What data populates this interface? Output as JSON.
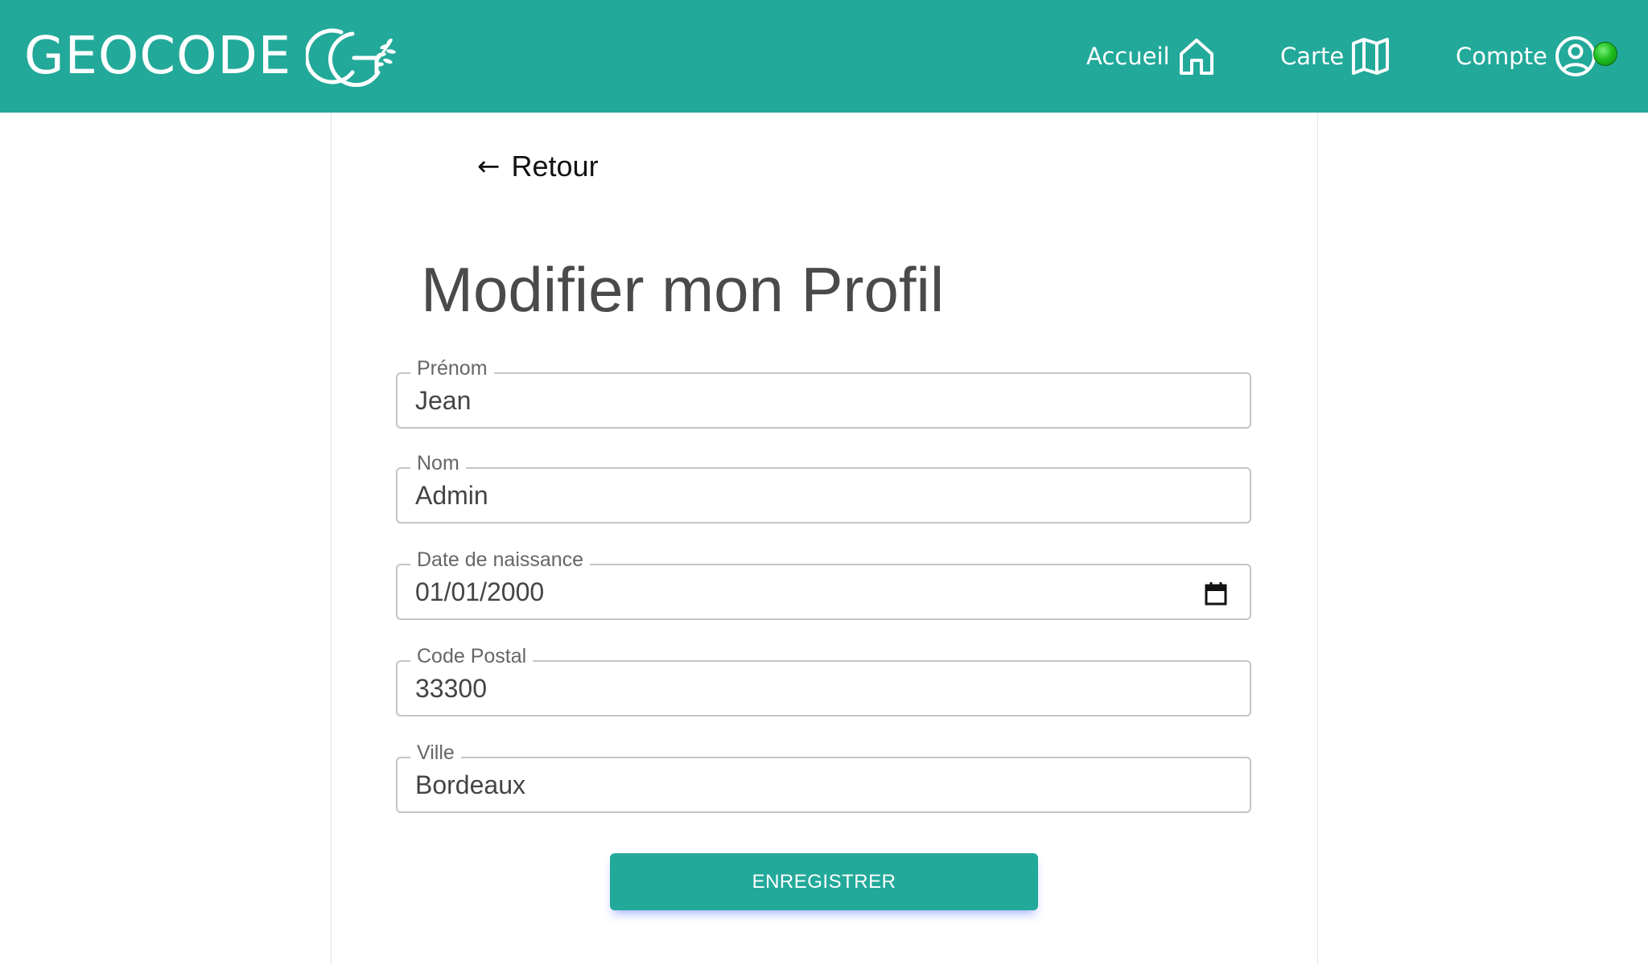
{
  "header": {
    "brand": "GEOCODE",
    "nav": {
      "home": "Accueil",
      "map": "Carte",
      "account": "Compte"
    },
    "status_color": "#22c022"
  },
  "page": {
    "back_label": "Retour",
    "title": "Modifier mon Profil"
  },
  "form": {
    "first_name": {
      "label": "Prénom",
      "value": "Jean"
    },
    "last_name": {
      "label": "Nom",
      "value": "Admin"
    },
    "birth_date": {
      "label": "Date de naissance",
      "value": "01/01/2000"
    },
    "postal_code": {
      "label": "Code Postal",
      "value": "33300"
    },
    "city": {
      "label": "Ville",
      "value": "Bordeaux"
    },
    "submit_label": "ENREGISTRER"
  },
  "theme": {
    "accent": "#22a99a"
  },
  "icons": {
    "brand": "geocode-logo",
    "home": "home-icon",
    "map": "map-icon",
    "account": "user-circle-icon",
    "status": "online-status-icon",
    "back": "arrow-left-icon",
    "calendar": "calendar-icon"
  }
}
